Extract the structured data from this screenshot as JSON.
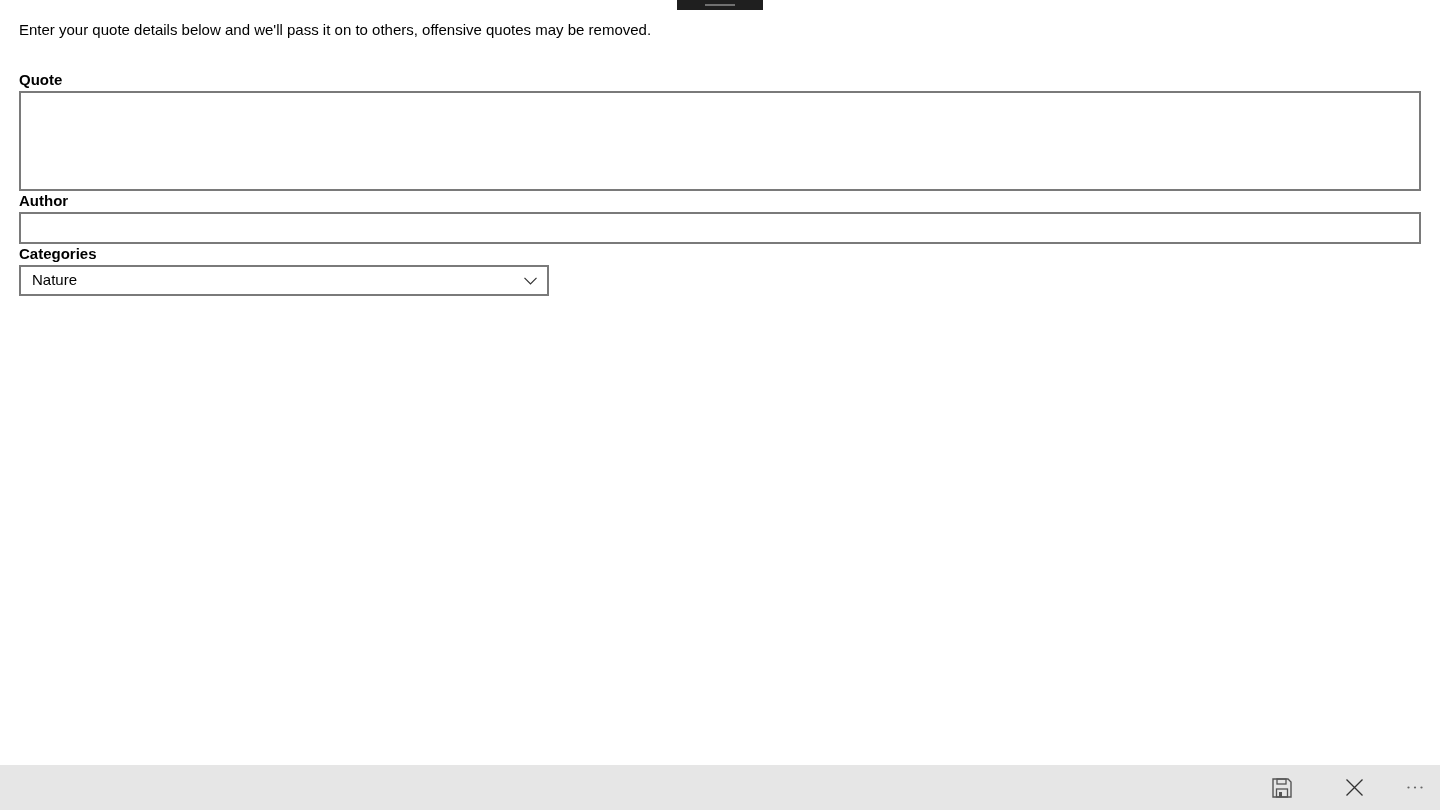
{
  "intro": "Enter your quote details below and we'll pass it on to others, offensive quotes may be removed.",
  "fields": [
    {
      "kind": "textarea",
      "label": "Quote"
    },
    {
      "kind": "text",
      "label": "Author"
    },
    {
      "kind": "select",
      "label": "Categories",
      "value": "Nature"
    }
  ],
  "app_bar": {
    "buttons": [
      {
        "kind": "save"
      },
      {
        "kind": "close"
      },
      {
        "kind": "more"
      }
    ]
  }
}
